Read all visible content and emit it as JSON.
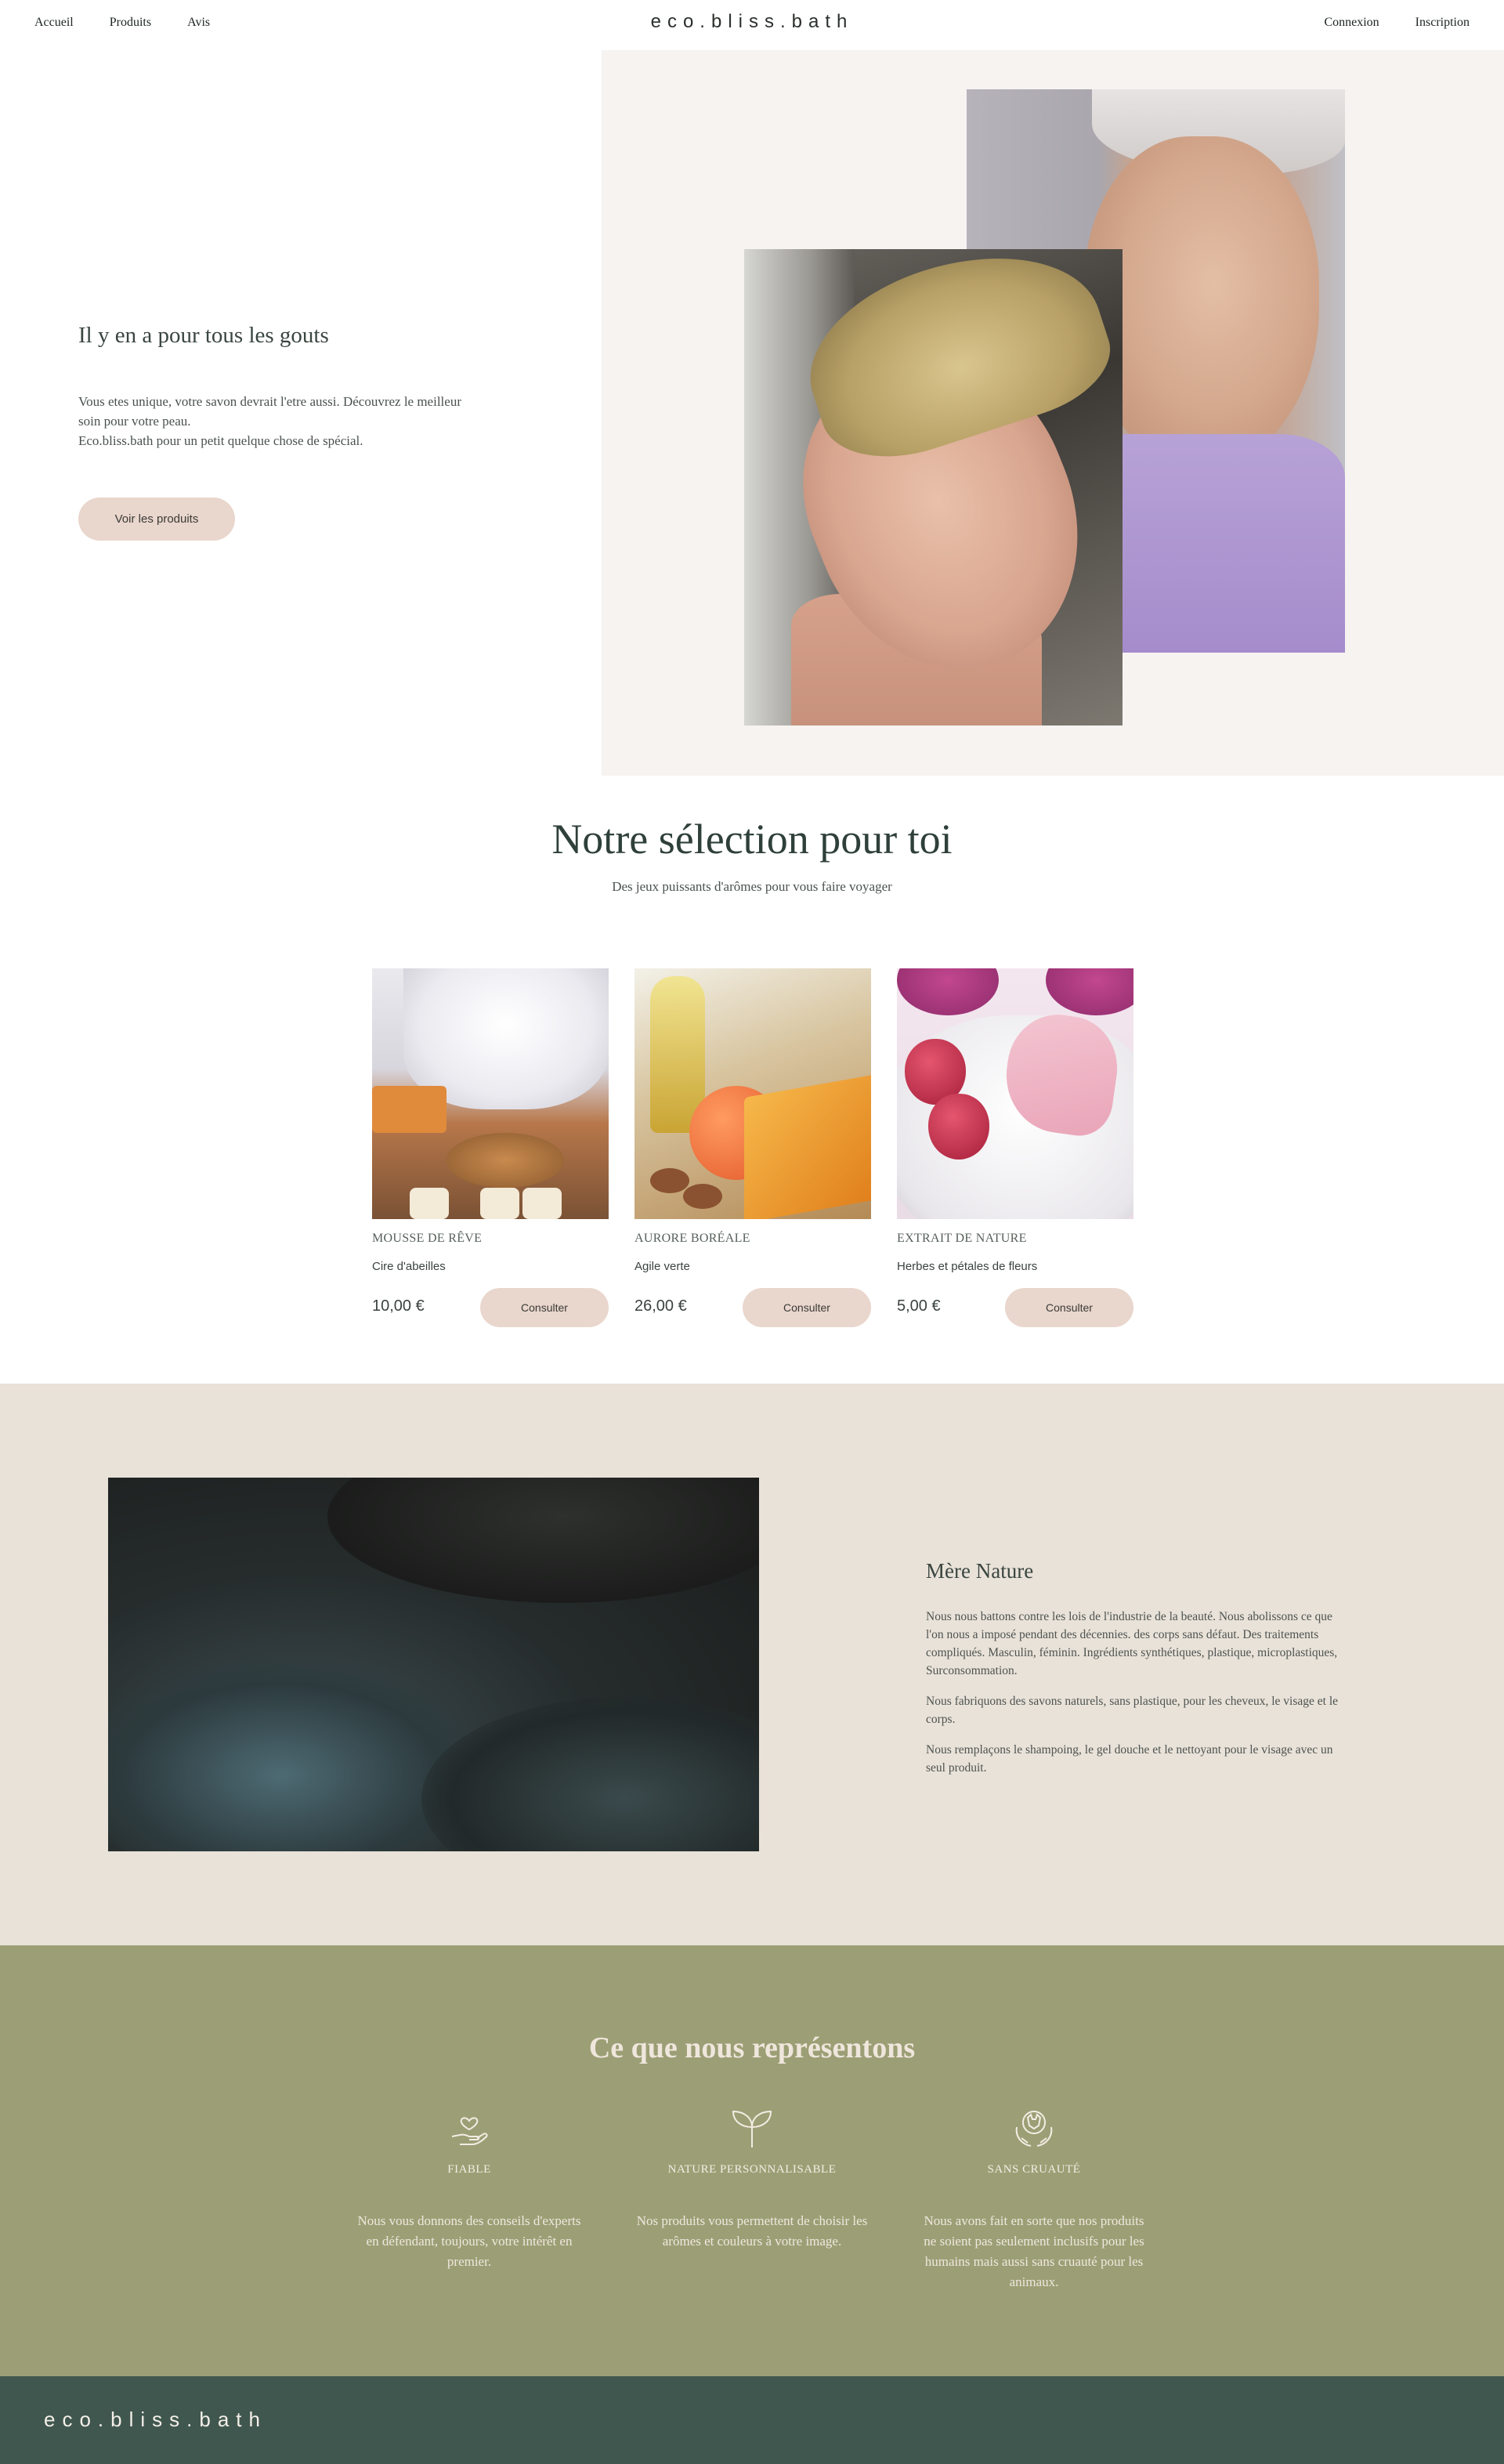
{
  "nav": {
    "links": [
      "Accueil",
      "Produits",
      "Avis"
    ],
    "logo": "eco.bliss.bath",
    "login": "Connexion",
    "signup": "Inscription"
  },
  "hero": {
    "title": "Il y en a pour tous les gouts",
    "text_lines": [
      "Vous etes unique, votre savon devrait l'etre aussi. Découvrez le meilleur",
      "soin pour votre peau.",
      "Eco.bliss.bath pour un petit quelque chose de spécial."
    ],
    "button": "Voir les produits"
  },
  "selection": {
    "title": "Notre sélection pour toi",
    "subtitle": "Des jeux puissants d'arômes pour vous faire voyager",
    "products": [
      {
        "name": "MOUSSE DE RÊVE",
        "description": "Cire d'abeilles",
        "price": "10,00 €",
        "button": "Consulter"
      },
      {
        "name": "AURORE BORÉALE",
        "description": "Agile verte",
        "price": "26,00 €",
        "button": "Consulter"
      },
      {
        "name": "EXTRAIT DE NATURE",
        "description": "Herbes et pétales de fleurs",
        "price": "5,00 €",
        "button": "Consulter"
      }
    ]
  },
  "nature": {
    "title": "Mère Nature",
    "paragraphs": [
      "Nous nous battons contre les lois de l'industrie de la beauté. Nous abolissons ce que l'on nous a imposé pendant des décennies. des corps sans défaut. Des traitements compliqués. Masculin, féminin. Ingrédients synthétiques, plastique, microplastiques, Surconsommation.",
      "Nous fabriquons des savons naturels, sans plastique, pour les cheveux, le visage et le corps.",
      "Nous remplaçons le shampoing, le gel douche et le nettoyant pour le visage avec un seul produit."
    ]
  },
  "values": {
    "title": "Ce que nous représentons",
    "items": [
      {
        "icon": "hand-heart-icon",
        "title": "FIABLE",
        "text": "Nous vous donnons des conseils d'experts en défendant, toujours, votre intérêt en premier."
      },
      {
        "icon": "sprout-icon",
        "title": "NATURE PERSONNALISABLE",
        "text": "Nos produits vous permettent de choisir les arômes et couleurs à votre image."
      },
      {
        "icon": "cruelty-free-icon",
        "title": "SANS CRUAUTÉ",
        "text": "Nous avons fait en sorte que nos produits ne soient pas seulement inclusifs pour les humains mais aussi sans cruauté pour les animaux."
      }
    ]
  },
  "footer": {
    "logo": "eco.bliss.bath"
  },
  "colors": {
    "hero_bg": "#f6f3f1",
    "pill": "#e9d6cd",
    "nature_bg": "#e9e2d9",
    "values_bg": "#9c9f75",
    "footer_bg": "#40574f",
    "heading": "#2f403a"
  }
}
